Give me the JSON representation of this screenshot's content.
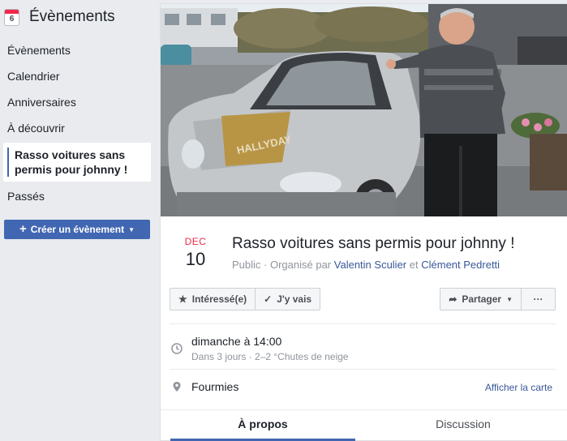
{
  "sidebar": {
    "calendar_icon_day": "6",
    "title": "Évènements",
    "items": [
      {
        "label": "Évènements"
      },
      {
        "label": "Calendrier"
      },
      {
        "label": "Anniversaires"
      },
      {
        "label": "À découvrir"
      },
      {
        "label": "Rasso voitures sans permis pour johnny !"
      },
      {
        "label": "Passés"
      }
    ],
    "create_button": "Créer un évènement"
  },
  "event": {
    "month": "DEC",
    "day": "10",
    "title": "Rasso voitures sans permis pour johnny !",
    "visibility": "Public",
    "organized_by": "· Organisé par",
    "organizer_1": "Valentin Sculier",
    "and": "et",
    "organizer_2": "Clément Pedretti",
    "cover_sticker_text": "HALLYDAY"
  },
  "actions": {
    "interested": "Intéressé(e)",
    "going": "J'y vais",
    "share": "Partager",
    "more": "···"
  },
  "details": {
    "time": "dimanche à 14:00",
    "time_sub": "Dans 3 jours · 2–2 °Chutes de neige",
    "location": "Fourmies",
    "map_link": "Afficher la carte"
  },
  "tabs": {
    "about": "À propos",
    "discussion": "Discussion"
  },
  "colors": {
    "accent": "#4267b2",
    "month_red": "#f02849",
    "link": "#385898"
  }
}
